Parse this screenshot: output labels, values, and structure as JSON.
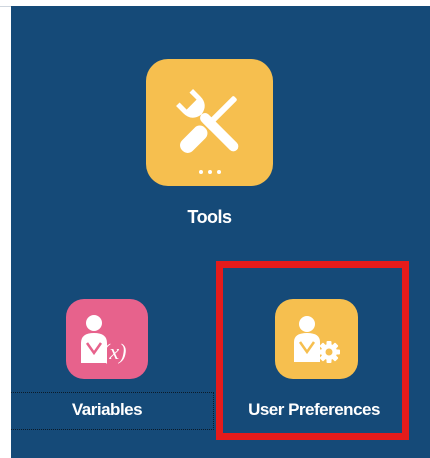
{
  "tiles": {
    "tools": {
      "label": "Tools",
      "color": "#f6bf4f",
      "icon": "wrench-screwdriver-icon"
    },
    "variables": {
      "label": "Variables",
      "color": "#e7628c",
      "icon": "user-variable-icon"
    },
    "user_preferences": {
      "label": "User Preferences",
      "color": "#f6bf4f",
      "icon": "user-gear-icon",
      "highlighted": true
    }
  },
  "colors": {
    "background": "#154a78",
    "highlight": "#e51b1b"
  }
}
